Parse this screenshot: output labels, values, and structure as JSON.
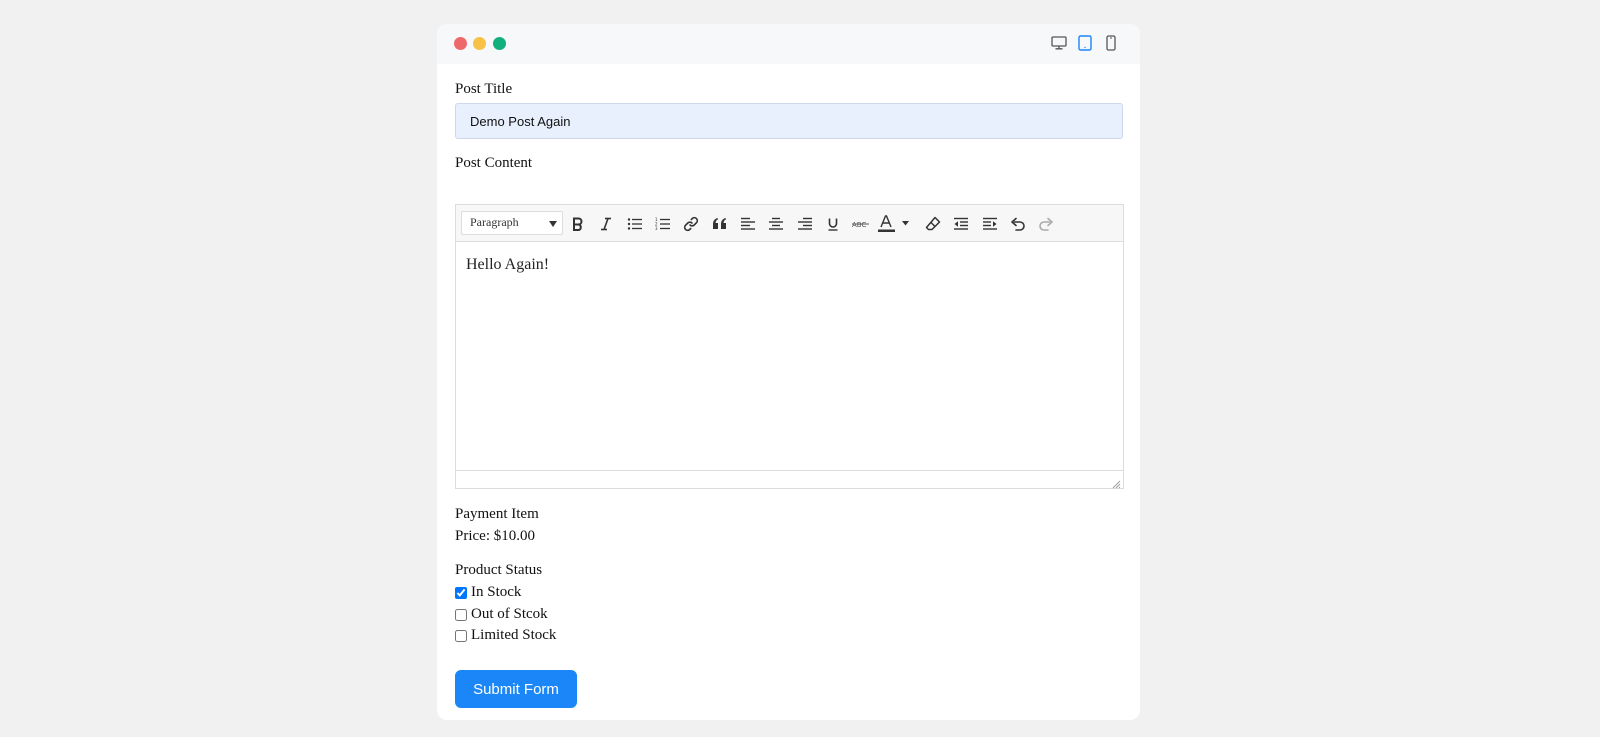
{
  "window": {
    "traffic_lights": [
      "close",
      "minimize",
      "maximize"
    ],
    "device_icons": [
      "desktop-icon",
      "tablet-icon",
      "mobile-icon"
    ],
    "active_device": "tablet-icon",
    "accent_color": "#1a86f7"
  },
  "form": {
    "title_label": "Post Title",
    "title_value": "Demo Post Again",
    "content_label": "Post Content",
    "editor": {
      "format_select": "Paragraph",
      "toolbar_buttons": [
        "bold-icon",
        "italic-icon",
        "bullet-list-icon",
        "numbered-list-icon",
        "link-icon",
        "blockquote-icon",
        "align-left-icon",
        "align-center-icon",
        "align-right-icon",
        "underline-icon",
        "strikethrough-icon",
        "text-color-icon",
        "clear-formatting-icon",
        "outdent-icon",
        "indent-icon",
        "undo-icon",
        "redo-icon"
      ],
      "body_text": "Hello Again!"
    },
    "payment_label": "Payment Item",
    "price_text": "Price: $10.00",
    "status_label": "Product Status",
    "status_options": [
      {
        "label": "In Stock",
        "checked": true
      },
      {
        "label": "Out of Stcok",
        "checked": false
      },
      {
        "label": "Limited Stock",
        "checked": false
      }
    ],
    "submit_label": "Submit Form"
  }
}
